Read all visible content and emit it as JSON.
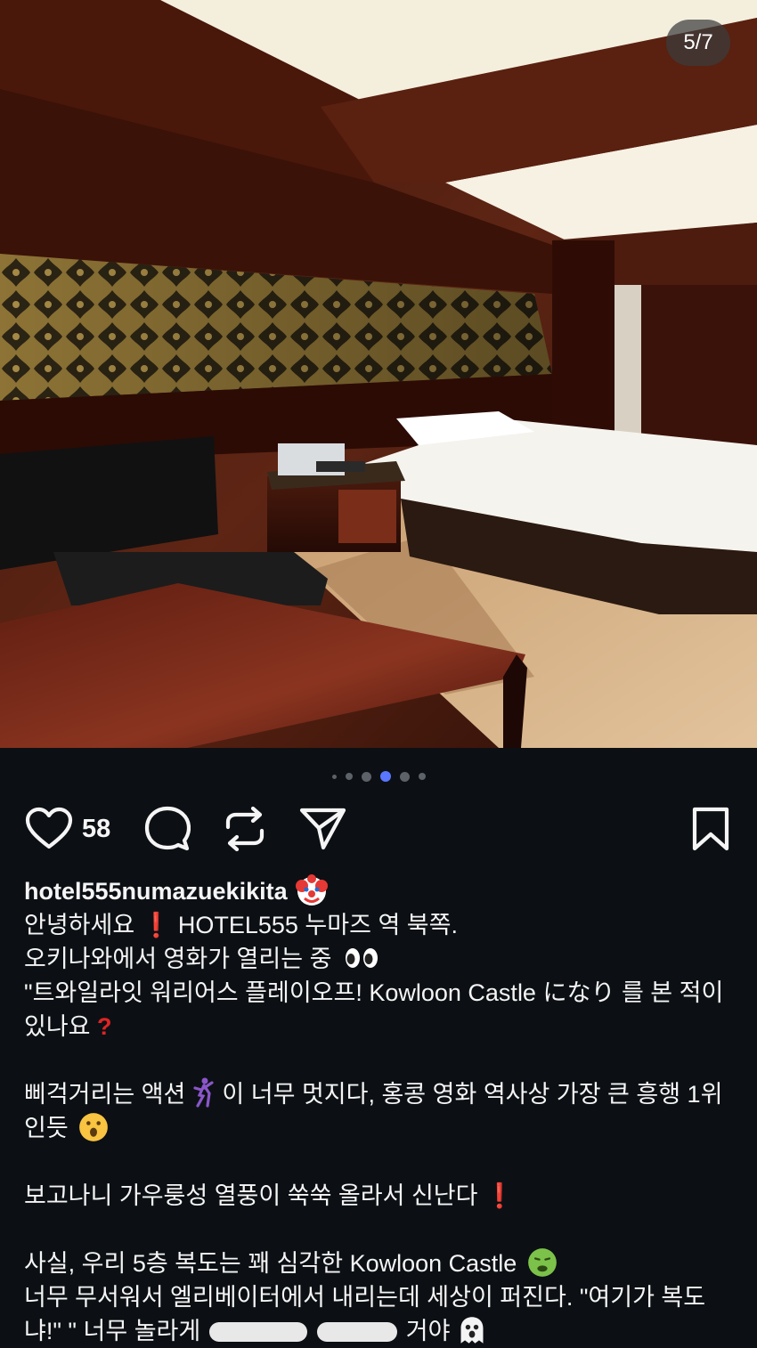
{
  "photo": {
    "counter": "5/7",
    "description_icon": "hotel-room-photo"
  },
  "carousel": {
    "total_dots": 6,
    "active_index": 3
  },
  "actions": {
    "like_count": "58",
    "icons": [
      "heart-icon",
      "comment-icon",
      "repost-icon",
      "share-icon",
      "bookmark-icon"
    ]
  },
  "caption": {
    "username": "hotel555numazuekikita",
    "username_emoji": "clown-face-icon",
    "line1": "안녕하세요",
    "line1b": "HOTEL555 누마즈 역 북쪽.",
    "line2": "오키나와에서 영화가 열리는 중",
    "line3": "\"트와일라잇 워리어스 플레이오프! Kowloon Castle になり 를 본 적이 있나요",
    "para2": "삐걱거리는 액션",
    "para2b": "이 너무 멋지다, 홍콩 영화 역사상 가장 큰 흥행 1위인듯",
    "para3": "보고나니 가우룽성 열풍이 쑥쑥 올라서 신난다",
    "para4a": "사실, 우리 5층 복도는 꽤 심각한 Kowloon Castle",
    "para4b": "너무 무서워서 엘리베이터에서 내리는데 세상이 퍼진다. \"여기가 복도냐!\" \" 너무 놀라게",
    "para4c": "거야"
  },
  "colors": {
    "background": "#0c1014",
    "text": "#f5f5f5",
    "accent_dot": "#5a78ff",
    "exclaim": "#e02424"
  }
}
